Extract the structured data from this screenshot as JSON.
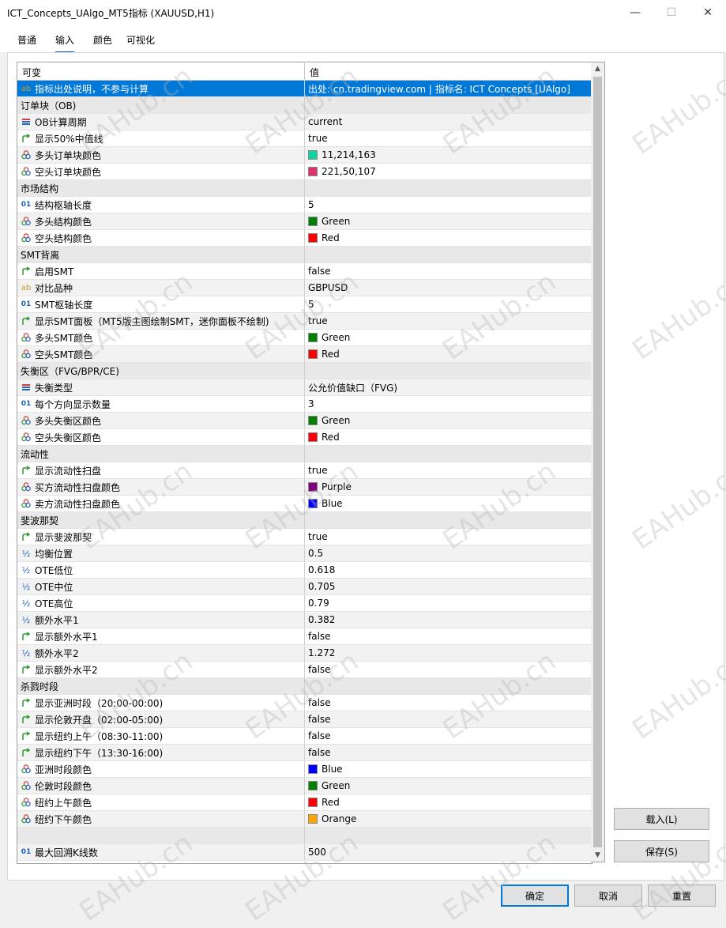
{
  "window": {
    "title": "ICT_Concepts_UAlgo_MT5指标 (XAUUSD,H1)",
    "minimize": "—",
    "maximize": "☐",
    "close": "✕"
  },
  "tabs": [
    "普通",
    "输入",
    "颜色",
    "可视化"
  ],
  "columns": {
    "name": "可变",
    "value": "值"
  },
  "rows": [
    {
      "kind": "param",
      "icon": "text",
      "name": "指标出处说明，不参与计算",
      "value": "出处: cn.tradingview.com | 指标名: ICT Concepts [UAlgo]",
      "selected": true
    },
    {
      "kind": "category",
      "name": "订单块（OB)"
    },
    {
      "kind": "param",
      "icon": "enum",
      "name": "OB计算周期",
      "value": "current"
    },
    {
      "kind": "param",
      "icon": "bool",
      "name": "显示50%中值线",
      "value": "true"
    },
    {
      "kind": "param",
      "icon": "color",
      "name": "多头订单块颜色",
      "value": "11,214,163",
      "swatch": "#0bd6a3"
    },
    {
      "kind": "param",
      "icon": "color",
      "name": "空头订单块颜色",
      "value": "221,50,107",
      "swatch": "#dd326b"
    },
    {
      "kind": "category",
      "name": "市场结构"
    },
    {
      "kind": "param",
      "icon": "int",
      "name": "结构枢轴长度",
      "value": "5"
    },
    {
      "kind": "param",
      "icon": "color",
      "name": "多头结构颜色",
      "value": "Green",
      "swatch": "#008000"
    },
    {
      "kind": "param",
      "icon": "color",
      "name": "空头结构颜色",
      "value": "Red",
      "swatch": "#ff0000"
    },
    {
      "kind": "category",
      "name": "SMT背离"
    },
    {
      "kind": "param",
      "icon": "bool",
      "name": "启用SMT",
      "value": "false"
    },
    {
      "kind": "param",
      "icon": "text",
      "name": "对比品种",
      "value": "GBPUSD"
    },
    {
      "kind": "param",
      "icon": "int",
      "name": "SMT枢轴长度",
      "value": "5"
    },
    {
      "kind": "param",
      "icon": "bool",
      "name": "显示SMT面板（MT5版主图绘制SMT，迷你面板不绘制)",
      "value": "true"
    },
    {
      "kind": "param",
      "icon": "color",
      "name": "多头SMT颜色",
      "value": "Green",
      "swatch": "#008000"
    },
    {
      "kind": "param",
      "icon": "color",
      "name": "空头SMT颜色",
      "value": "Red",
      "swatch": "#ff0000"
    },
    {
      "kind": "category",
      "name": "失衡区（FVG/BPR/CE)"
    },
    {
      "kind": "param",
      "icon": "enum",
      "name": "失衡类型",
      "value": "公允价值缺口（FVG)"
    },
    {
      "kind": "param",
      "icon": "int",
      "name": "每个方向显示数量",
      "value": "3"
    },
    {
      "kind": "param",
      "icon": "color",
      "name": "多头失衡区颜色",
      "value": "Green",
      "swatch": "#008000"
    },
    {
      "kind": "param",
      "icon": "color",
      "name": "空头失衡区颜色",
      "value": "Red",
      "swatch": "#ff0000"
    },
    {
      "kind": "category",
      "name": "流动性"
    },
    {
      "kind": "param",
      "icon": "bool",
      "name": "显示流动性扫盘",
      "value": "true"
    },
    {
      "kind": "param",
      "icon": "color",
      "name": "买方流动性扫盘颜色",
      "value": "Purple",
      "swatch": "#800080"
    },
    {
      "kind": "param",
      "icon": "color",
      "name": "卖方流动性扫盘颜色",
      "value": "Blue",
      "swatch": "#0000ff"
    },
    {
      "kind": "category",
      "name": "斐波那契"
    },
    {
      "kind": "param",
      "icon": "bool",
      "name": "显示斐波那契",
      "value": "true"
    },
    {
      "kind": "param",
      "icon": "double",
      "name": "均衡位置",
      "value": "0.5"
    },
    {
      "kind": "param",
      "icon": "double",
      "name": "OTE低位",
      "value": "0.618"
    },
    {
      "kind": "param",
      "icon": "double",
      "name": "OTE中位",
      "value": "0.705"
    },
    {
      "kind": "param",
      "icon": "double",
      "name": "OTE高位",
      "value": "0.79"
    },
    {
      "kind": "param",
      "icon": "double",
      "name": "额外水平1",
      "value": "0.382"
    },
    {
      "kind": "param",
      "icon": "bool",
      "name": "显示额外水平1",
      "value": "false"
    },
    {
      "kind": "param",
      "icon": "double",
      "name": "额外水平2",
      "value": "1.272"
    },
    {
      "kind": "param",
      "icon": "bool",
      "name": "显示额外水平2",
      "value": "false"
    },
    {
      "kind": "category",
      "name": "杀戮时段"
    },
    {
      "kind": "param",
      "icon": "bool",
      "name": "显示亚洲时段（20:00-00:00)",
      "value": "false"
    },
    {
      "kind": "param",
      "icon": "bool",
      "name": "显示伦敦开盘（02:00-05:00)",
      "value": "false"
    },
    {
      "kind": "param",
      "icon": "bool",
      "name": "显示纽约上午（08:30-11:00)",
      "value": "false"
    },
    {
      "kind": "param",
      "icon": "bool",
      "name": "显示纽约下午（13:30-16:00)",
      "value": "false"
    },
    {
      "kind": "param",
      "icon": "color",
      "name": "亚洲时段颜色",
      "value": "Blue",
      "swatch": "#0000ff"
    },
    {
      "kind": "param",
      "icon": "color",
      "name": "伦敦时段颜色",
      "value": "Green",
      "swatch": "#008000"
    },
    {
      "kind": "param",
      "icon": "color",
      "name": "纽约上午颜色",
      "value": "Red",
      "swatch": "#ff0000"
    },
    {
      "kind": "param",
      "icon": "color",
      "name": "纽约下午颜色",
      "value": "Orange",
      "swatch": "#ffa500"
    },
    {
      "kind": "category",
      "name": ""
    },
    {
      "kind": "param",
      "icon": "int",
      "name": "最大回溯K线数",
      "value": "500"
    }
  ],
  "side_buttons": {
    "load": "载入(L)",
    "save": "保存(S)"
  },
  "footer_buttons": {
    "ok": "确定",
    "cancel": "取消",
    "reset": "重置"
  },
  "watermark": "EAHub.cn",
  "icons": {
    "text": "ab",
    "enum": "≡",
    "int": "01",
    "double": "½",
    "bool": "↱",
    "color": "ꝏ"
  }
}
